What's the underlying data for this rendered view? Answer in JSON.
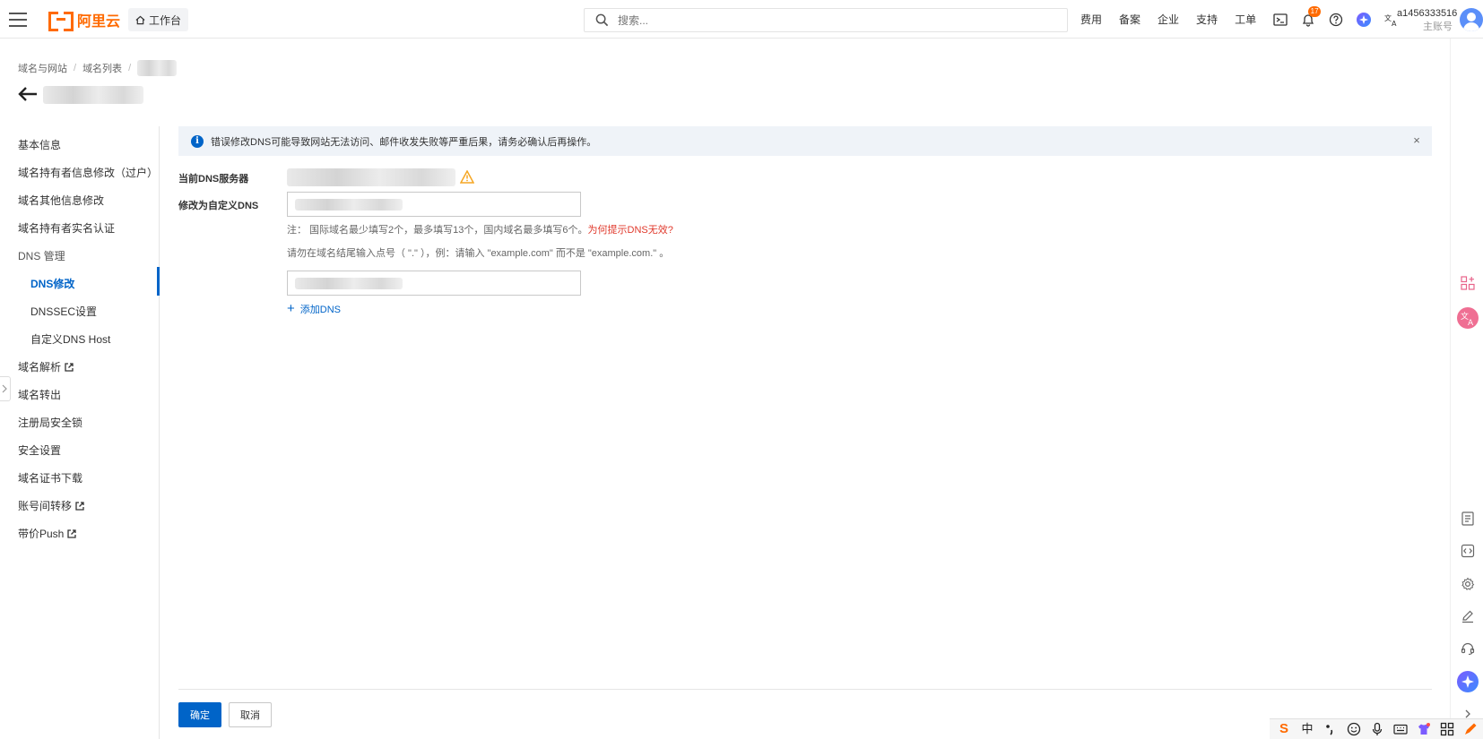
{
  "topbar": {
    "logo_text": "阿里云",
    "workbench_label": "工作台",
    "search_placeholder": "搜索...",
    "nav_links": [
      "费用",
      "备案",
      "企业",
      "支持",
      "工单"
    ],
    "notification_count": "17",
    "account_name": "a1456333516",
    "account_type": "主账号",
    "brand_color": "#ff6a00"
  },
  "breadcrumb": {
    "items": [
      "域名与网站",
      "域名列表"
    ],
    "separator": "/"
  },
  "sidebar": {
    "items": [
      {
        "label": "基本信息"
      },
      {
        "label": "域名持有者信息修改（过户）"
      },
      {
        "label": "域名其他信息修改"
      },
      {
        "label": "域名持有者实名认证"
      },
      {
        "label": "DNS 管理"
      },
      {
        "label": "DNS修改"
      },
      {
        "label": "DNSSEC设置"
      },
      {
        "label": "自定义DNS Host"
      },
      {
        "label": "域名解析"
      },
      {
        "label": "域名转出"
      },
      {
        "label": "注册局安全锁"
      },
      {
        "label": "安全设置"
      },
      {
        "label": "域名证书下载"
      },
      {
        "label": "账号间转移"
      },
      {
        "label": "带价Push"
      }
    ],
    "active": "DNS修改",
    "accent_color": "#0064c8"
  },
  "main": {
    "alert": "错误修改DNS可能导致网站无法访问、邮件收发失败等严重后果，请务必确认后再操作。",
    "current_dns_label": "当前DNS服务器",
    "custom_dns_label": "修改为自定义DNS",
    "note_prefix": "注：  国际域名最少填写2个，最多填写13个，国内域名最多填写6个。",
    "note_link": "为何提示DNS无效?",
    "note_dot": "请勿在域名结尾输入点号（ \".\" ），例：请输入 \"example.com\" 而不是 \"example.com.\" 。",
    "add_dns": "添加DNS",
    "confirm": "确定",
    "cancel": "取消"
  },
  "ime": {
    "mode": "中"
  }
}
